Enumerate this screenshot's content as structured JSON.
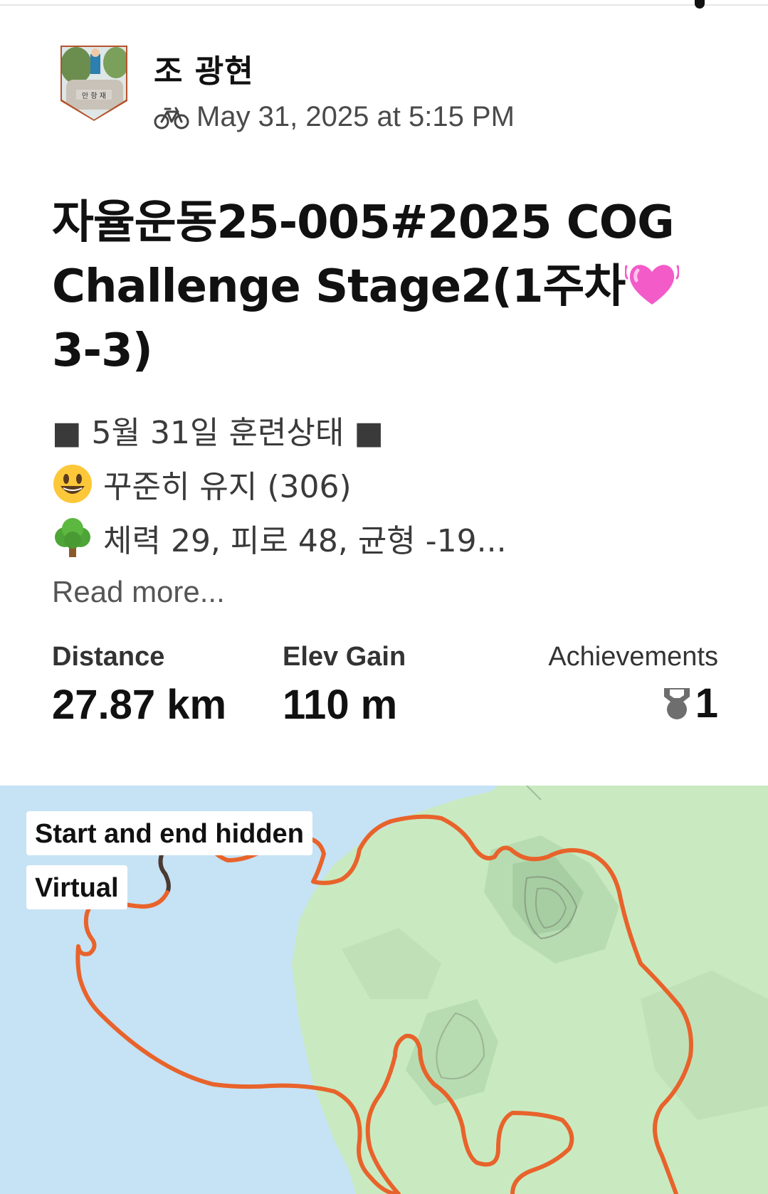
{
  "activity": {
    "athlete_name": "조 광현",
    "sport_icon": "bike-icon",
    "date_text": "May 31, 2025 at 5:15 PM",
    "title_lines": [
      "자율운동25-005#2025 COG",
      "Challenge Stage2(1주차",
      "3-3)"
    ],
    "title_emoji": "heart-emoji",
    "description": [
      {
        "emoji": "",
        "text": "■ 5월 31일 훈련상태 ■"
      },
      {
        "emoji": "smiley-emoji",
        "text": "꾸준히 유지 (306)"
      },
      {
        "emoji": "tree-emoji",
        "text": "체력 29, 피로 48, 균형 -19..."
      }
    ],
    "read_more": "Read more..."
  },
  "stats": {
    "distance": {
      "label": "Distance",
      "value": "27.87 km"
    },
    "elev_gain": {
      "label": "Elev Gain",
      "value": "110 m"
    },
    "achievements": {
      "label": "Achievements",
      "value": "1",
      "icon": "medal-icon"
    }
  },
  "map": {
    "badges": {
      "start_end": "Start and end hidden",
      "virtual": "Virtual"
    },
    "route_color": "#e8632b",
    "water_color": "#c6e2f5",
    "land_color": "#c9eac1"
  }
}
